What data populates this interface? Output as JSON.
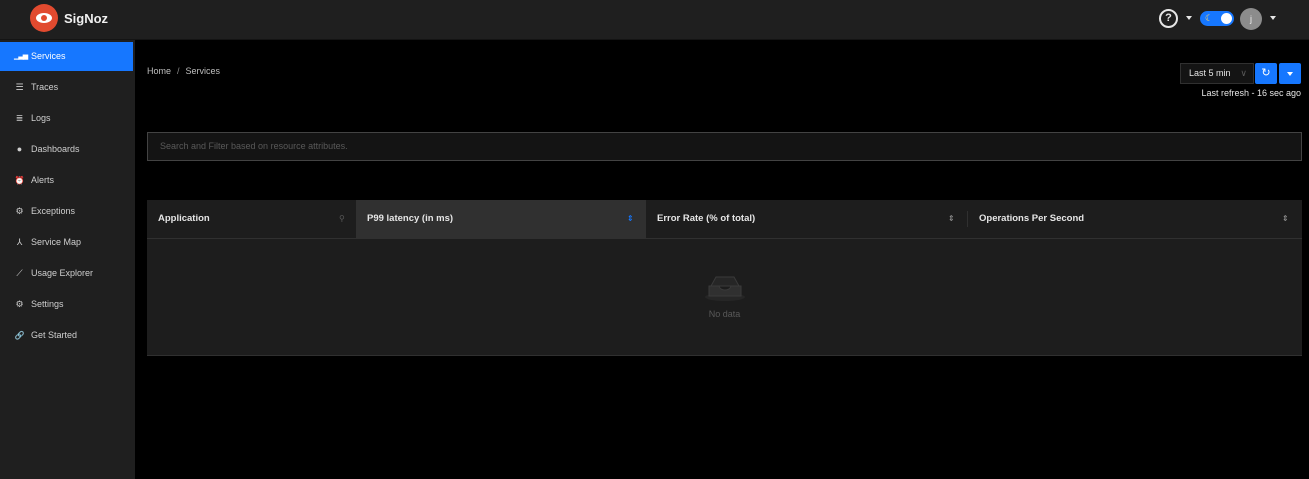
{
  "app": {
    "name": "SigNoz"
  },
  "header": {
    "help_icon": "question-circle-icon",
    "help_label": "?",
    "theme_toggle_icon": "moon-icon",
    "theme_toggle_glyph": "☾",
    "avatar_initial": "j",
    "accent_color": "#1677ff",
    "brand_color": "#e14a2f"
  },
  "sidebar": {
    "items": [
      {
        "label": "Services",
        "icon": "bar-chart-icon",
        "glyph": "▁▃▅",
        "active": true
      },
      {
        "label": "Traces",
        "icon": "menu-icon",
        "glyph": "☰"
      },
      {
        "label": "Logs",
        "icon": "align-left-icon",
        "glyph": "≣"
      },
      {
        "label": "Dashboards",
        "icon": "dashboard-icon",
        "glyph": "●"
      },
      {
        "label": "Alerts",
        "icon": "alarm-icon",
        "glyph": "⏰"
      },
      {
        "label": "Exceptions",
        "icon": "bug-icon",
        "glyph": "⚙"
      },
      {
        "label": "Service Map",
        "icon": "deployment-unit-icon",
        "glyph": "⅄"
      },
      {
        "label": "Usage Explorer",
        "icon": "line-chart-icon",
        "glyph": "⟋"
      },
      {
        "label": "Settings",
        "icon": "settings-icon",
        "glyph": "⚙"
      },
      {
        "label": "Get Started",
        "icon": "link-icon",
        "glyph": "🔗"
      }
    ]
  },
  "breadcrumb": {
    "home": "Home",
    "separator": "/",
    "current": "Services"
  },
  "time_picker": {
    "selected": "Last 5 min",
    "chevron": "∨",
    "refresh_glyph": "↻",
    "last_refresh": "Last refresh - 16 sec ago"
  },
  "search": {
    "placeholder": "Search and Filter based on resource attributes."
  },
  "table": {
    "columns": [
      {
        "label": "Application",
        "control": "search-icon"
      },
      {
        "label": "P99 latency (in ms)",
        "control": "sort-icon",
        "sorted": true
      },
      {
        "label": "Error Rate (% of total)",
        "control": "sort-icon"
      },
      {
        "label": "Operations Per Second",
        "control": "sort-icon"
      }
    ],
    "search_glyph": "⚲",
    "sort_glyph": "⇕",
    "empty_text": "No data"
  }
}
